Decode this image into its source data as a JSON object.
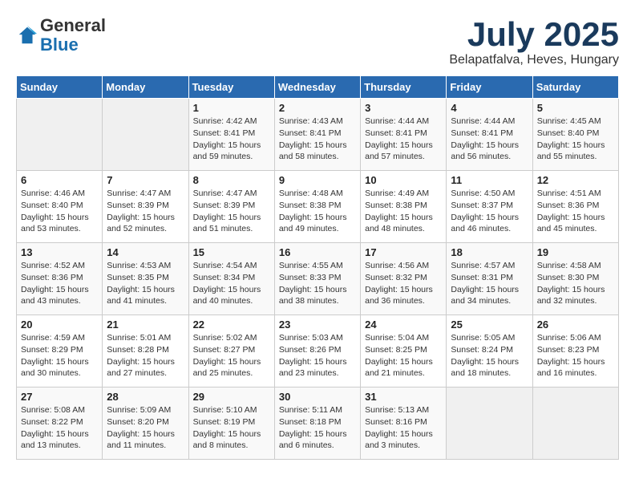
{
  "logo": {
    "general": "General",
    "blue": "Blue"
  },
  "header": {
    "month": "July 2025",
    "location": "Belapatfalva, Heves, Hungary"
  },
  "weekdays": [
    "Sunday",
    "Monday",
    "Tuesday",
    "Wednesday",
    "Thursday",
    "Friday",
    "Saturday"
  ],
  "weeks": [
    [
      {
        "day": "",
        "sunrise": "",
        "sunset": "",
        "daylight": ""
      },
      {
        "day": "",
        "sunrise": "",
        "sunset": "",
        "daylight": ""
      },
      {
        "day": "1",
        "sunrise": "Sunrise: 4:42 AM",
        "sunset": "Sunset: 8:41 PM",
        "daylight": "Daylight: 15 hours and 59 minutes."
      },
      {
        "day": "2",
        "sunrise": "Sunrise: 4:43 AM",
        "sunset": "Sunset: 8:41 PM",
        "daylight": "Daylight: 15 hours and 58 minutes."
      },
      {
        "day": "3",
        "sunrise": "Sunrise: 4:44 AM",
        "sunset": "Sunset: 8:41 PM",
        "daylight": "Daylight: 15 hours and 57 minutes."
      },
      {
        "day": "4",
        "sunrise": "Sunrise: 4:44 AM",
        "sunset": "Sunset: 8:41 PM",
        "daylight": "Daylight: 15 hours and 56 minutes."
      },
      {
        "day": "5",
        "sunrise": "Sunrise: 4:45 AM",
        "sunset": "Sunset: 8:40 PM",
        "daylight": "Daylight: 15 hours and 55 minutes."
      }
    ],
    [
      {
        "day": "6",
        "sunrise": "Sunrise: 4:46 AM",
        "sunset": "Sunset: 8:40 PM",
        "daylight": "Daylight: 15 hours and 53 minutes."
      },
      {
        "day": "7",
        "sunrise": "Sunrise: 4:47 AM",
        "sunset": "Sunset: 8:39 PM",
        "daylight": "Daylight: 15 hours and 52 minutes."
      },
      {
        "day": "8",
        "sunrise": "Sunrise: 4:47 AM",
        "sunset": "Sunset: 8:39 PM",
        "daylight": "Daylight: 15 hours and 51 minutes."
      },
      {
        "day": "9",
        "sunrise": "Sunrise: 4:48 AM",
        "sunset": "Sunset: 8:38 PM",
        "daylight": "Daylight: 15 hours and 49 minutes."
      },
      {
        "day": "10",
        "sunrise": "Sunrise: 4:49 AM",
        "sunset": "Sunset: 8:38 PM",
        "daylight": "Daylight: 15 hours and 48 minutes."
      },
      {
        "day": "11",
        "sunrise": "Sunrise: 4:50 AM",
        "sunset": "Sunset: 8:37 PM",
        "daylight": "Daylight: 15 hours and 46 minutes."
      },
      {
        "day": "12",
        "sunrise": "Sunrise: 4:51 AM",
        "sunset": "Sunset: 8:36 PM",
        "daylight": "Daylight: 15 hours and 45 minutes."
      }
    ],
    [
      {
        "day": "13",
        "sunrise": "Sunrise: 4:52 AM",
        "sunset": "Sunset: 8:36 PM",
        "daylight": "Daylight: 15 hours and 43 minutes."
      },
      {
        "day": "14",
        "sunrise": "Sunrise: 4:53 AM",
        "sunset": "Sunset: 8:35 PM",
        "daylight": "Daylight: 15 hours and 41 minutes."
      },
      {
        "day": "15",
        "sunrise": "Sunrise: 4:54 AM",
        "sunset": "Sunset: 8:34 PM",
        "daylight": "Daylight: 15 hours and 40 minutes."
      },
      {
        "day": "16",
        "sunrise": "Sunrise: 4:55 AM",
        "sunset": "Sunset: 8:33 PM",
        "daylight": "Daylight: 15 hours and 38 minutes."
      },
      {
        "day": "17",
        "sunrise": "Sunrise: 4:56 AM",
        "sunset": "Sunset: 8:32 PM",
        "daylight": "Daylight: 15 hours and 36 minutes."
      },
      {
        "day": "18",
        "sunrise": "Sunrise: 4:57 AM",
        "sunset": "Sunset: 8:31 PM",
        "daylight": "Daylight: 15 hours and 34 minutes."
      },
      {
        "day": "19",
        "sunrise": "Sunrise: 4:58 AM",
        "sunset": "Sunset: 8:30 PM",
        "daylight": "Daylight: 15 hours and 32 minutes."
      }
    ],
    [
      {
        "day": "20",
        "sunrise": "Sunrise: 4:59 AM",
        "sunset": "Sunset: 8:29 PM",
        "daylight": "Daylight: 15 hours and 30 minutes."
      },
      {
        "day": "21",
        "sunrise": "Sunrise: 5:01 AM",
        "sunset": "Sunset: 8:28 PM",
        "daylight": "Daylight: 15 hours and 27 minutes."
      },
      {
        "day": "22",
        "sunrise": "Sunrise: 5:02 AM",
        "sunset": "Sunset: 8:27 PM",
        "daylight": "Daylight: 15 hours and 25 minutes."
      },
      {
        "day": "23",
        "sunrise": "Sunrise: 5:03 AM",
        "sunset": "Sunset: 8:26 PM",
        "daylight": "Daylight: 15 hours and 23 minutes."
      },
      {
        "day": "24",
        "sunrise": "Sunrise: 5:04 AM",
        "sunset": "Sunset: 8:25 PM",
        "daylight": "Daylight: 15 hours and 21 minutes."
      },
      {
        "day": "25",
        "sunrise": "Sunrise: 5:05 AM",
        "sunset": "Sunset: 8:24 PM",
        "daylight": "Daylight: 15 hours and 18 minutes."
      },
      {
        "day": "26",
        "sunrise": "Sunrise: 5:06 AM",
        "sunset": "Sunset: 8:23 PM",
        "daylight": "Daylight: 15 hours and 16 minutes."
      }
    ],
    [
      {
        "day": "27",
        "sunrise": "Sunrise: 5:08 AM",
        "sunset": "Sunset: 8:22 PM",
        "daylight": "Daylight: 15 hours and 13 minutes."
      },
      {
        "day": "28",
        "sunrise": "Sunrise: 5:09 AM",
        "sunset": "Sunset: 8:20 PM",
        "daylight": "Daylight: 15 hours and 11 minutes."
      },
      {
        "day": "29",
        "sunrise": "Sunrise: 5:10 AM",
        "sunset": "Sunset: 8:19 PM",
        "daylight": "Daylight: 15 hours and 8 minutes."
      },
      {
        "day": "30",
        "sunrise": "Sunrise: 5:11 AM",
        "sunset": "Sunset: 8:18 PM",
        "daylight": "Daylight: 15 hours and 6 minutes."
      },
      {
        "day": "31",
        "sunrise": "Sunrise: 5:13 AM",
        "sunset": "Sunset: 8:16 PM",
        "daylight": "Daylight: 15 hours and 3 minutes."
      },
      {
        "day": "",
        "sunrise": "",
        "sunset": "",
        "daylight": ""
      },
      {
        "day": "",
        "sunrise": "",
        "sunset": "",
        "daylight": ""
      }
    ]
  ]
}
